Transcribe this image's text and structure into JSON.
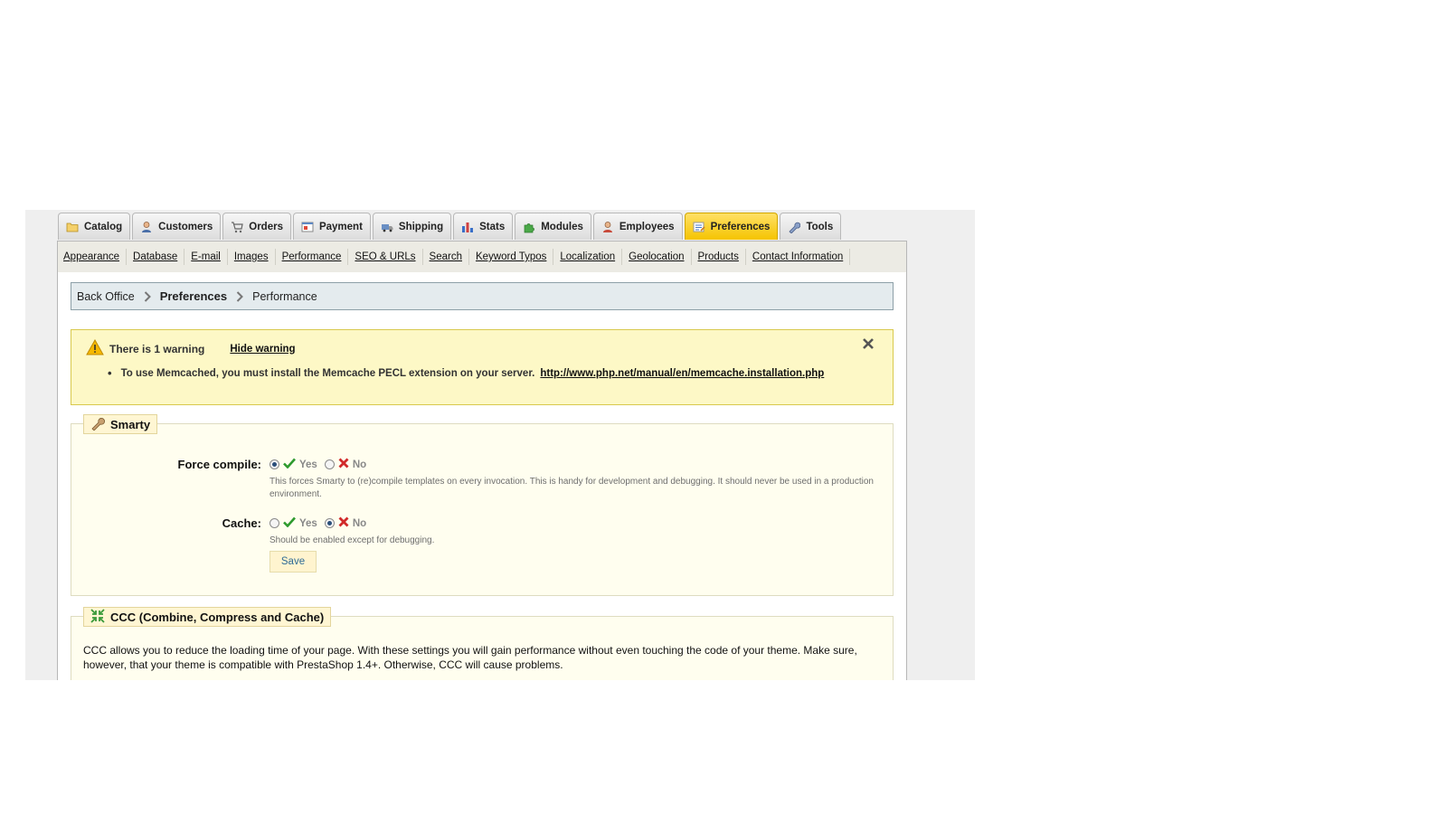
{
  "main_tabs": [
    {
      "label": "Catalog",
      "icon": "folder-icon",
      "active": false
    },
    {
      "label": "Customers",
      "icon": "user-icon",
      "active": false
    },
    {
      "label": "Orders",
      "icon": "cart-icon",
      "active": false
    },
    {
      "label": "Payment",
      "icon": "payment-icon",
      "active": false
    },
    {
      "label": "Shipping",
      "icon": "truck-icon",
      "active": false
    },
    {
      "label": "Stats",
      "icon": "bar-chart-icon",
      "active": false
    },
    {
      "label": "Modules",
      "icon": "puzzle-icon",
      "active": false
    },
    {
      "label": "Employees",
      "icon": "employee-icon",
      "active": false
    },
    {
      "label": "Preferences",
      "icon": "preferences-icon",
      "active": true
    },
    {
      "label": "Tools",
      "icon": "wrench-icon",
      "active": false
    }
  ],
  "sub_nav": [
    "Appearance",
    "Database",
    "E-mail",
    "Images",
    "Performance",
    "SEO & URLs",
    "Search",
    "Keyword Typos",
    "Localization",
    "Geolocation",
    "Products",
    "Contact Information"
  ],
  "breadcrumb": {
    "root": "Back Office",
    "section": "Preferences",
    "current": "Performance"
  },
  "warning": {
    "title": "There is 1 warning",
    "hide_label": "Hide warning",
    "message": "To use Memcached, you must install the Memcache PECL extension on your server.",
    "link": "http://www.php.net/manual/en/memcache.installation.php"
  },
  "smarty": {
    "legend": "Smarty",
    "force_compile": {
      "label": "Force compile:",
      "yes_label": "Yes",
      "no_label": "No",
      "selected": "yes",
      "hint": "This forces Smarty to (re)compile templates on every invocation. This is handy for development and debugging. It should never be used in a production environment."
    },
    "cache": {
      "label": "Cache:",
      "yes_label": "Yes",
      "no_label": "No",
      "selected": "no",
      "hint": "Should be enabled except for debugging."
    },
    "save_label": "Save"
  },
  "ccc": {
    "legend": "CCC (Combine, Compress and Cache)",
    "description": "CCC allows you to reduce the loading time of your page. With these settings you will gain performance without even touching the code of your theme. Make sure, however, that your theme is compatible with PrestaShop 1.4+. Otherwise, CCC will cause problems."
  },
  "colors": {
    "active_tab": "#f5c400",
    "warning_bg": "#fdf8c6",
    "fieldset_bg": "#fffeef",
    "breadcrumb_bg": "#e4ebee",
    "check_green": "#2e9a2e",
    "cross_red": "#d12a2a"
  }
}
